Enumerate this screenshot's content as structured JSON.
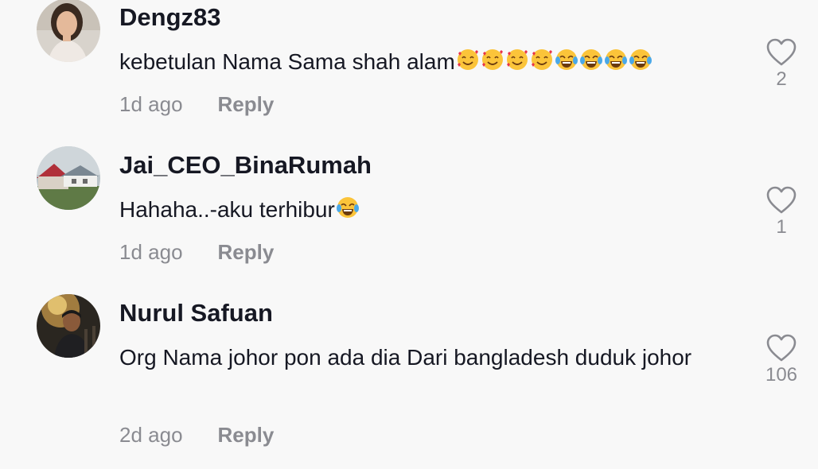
{
  "comments": [
    {
      "username": "Dengz83",
      "text": "kebetulan Nama Sama shah alam",
      "emojis": [
        "smiling-face-with-hearts",
        "smiling-face-with-hearts",
        "smiling-face-with-hearts",
        "smiling-face-with-hearts",
        "face-with-tears-of-joy",
        "face-with-tears-of-joy",
        "face-with-tears-of-joy",
        "face-with-tears-of-joy"
      ],
      "time": "1d ago",
      "reply_label": "Reply",
      "likes": "2"
    },
    {
      "username": "Jai_CEO_BinaRumah",
      "text": "Hahaha..-aku terhibur",
      "emojis": [
        "face-with-tears-of-joy"
      ],
      "time": "1d ago",
      "reply_label": "Reply",
      "likes": "1"
    },
    {
      "username": "Nurul Safuan",
      "text": "Org Nama johor pon ada dia Dari bangladesh duduk johor",
      "emojis": [],
      "time": "2d ago",
      "reply_label": "Reply",
      "likes": "106"
    }
  ],
  "colors": {
    "background": "#f8f8f8",
    "text_primary": "#161823",
    "text_secondary": "#8a8b91"
  }
}
